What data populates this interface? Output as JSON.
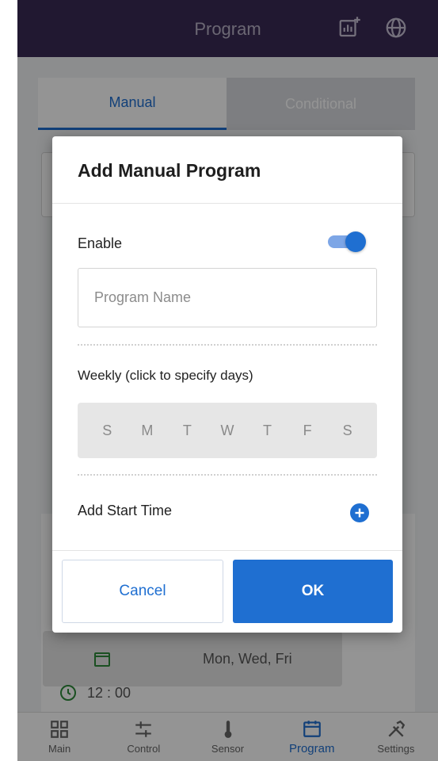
{
  "header": {
    "title": "Program",
    "icons": [
      "add-chart-icon",
      "globe-icon"
    ]
  },
  "tabs": [
    {
      "label": "Manual",
      "active": true
    },
    {
      "label": "Conditional",
      "active": false
    }
  ],
  "background": {
    "days_text": "Mon, Wed, Fri",
    "time_text": "12 : 00"
  },
  "dialog": {
    "title": "Add Manual Program",
    "enable_label": "Enable",
    "enable_on": true,
    "name_placeholder": "Program Name",
    "name_value": "",
    "weekly_label": "Weekly (click to specify days)",
    "days": [
      "S",
      "M",
      "T",
      "W",
      "T",
      "F",
      "S"
    ],
    "start_label": "Add Start Time",
    "cancel_label": "Cancel",
    "ok_label": "OK"
  },
  "nav": {
    "items": [
      {
        "label": "Main",
        "icon": "grid-icon"
      },
      {
        "label": "Control",
        "icon": "sliders-icon"
      },
      {
        "label": "Sensor",
        "icon": "thermometer-icon"
      },
      {
        "label": "Program",
        "icon": "calendar-icon",
        "active": true
      },
      {
        "label": "Settings",
        "icon": "tools-icon"
      }
    ]
  },
  "colors": {
    "header": "#3a2a55",
    "accent": "#1f6fd1",
    "overlay": "rgba(0,0,0,0.42)"
  }
}
